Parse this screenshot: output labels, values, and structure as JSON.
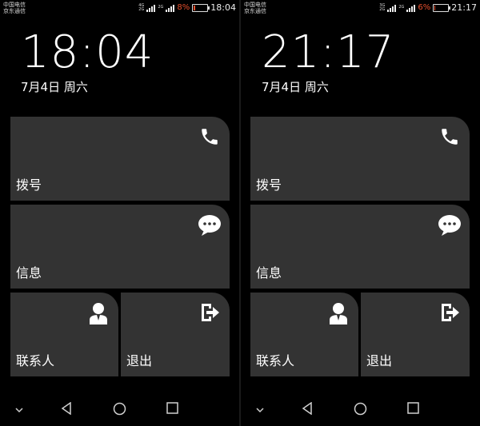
{
  "screens": [
    {
      "status": {
        "carrier1": "中国电信",
        "carrier2": "京东通信",
        "net1": "4G",
        "net2": "2G",
        "net3": "2G",
        "battery_pct": "8%",
        "battery_level": 0.08,
        "time": "18:04"
      },
      "clock": "18:04",
      "date": "7月4日 周六",
      "tiles": {
        "dial": "拨号",
        "message": "信息",
        "contacts": "联系人",
        "exit": "退出"
      }
    },
    {
      "status": {
        "carrier1": "中国电信",
        "carrier2": "京东通信",
        "net1": "3G",
        "net2": "2G",
        "net3": "2G",
        "battery_pct": "6%",
        "battery_level": 0.06,
        "time": "21:17"
      },
      "clock": "21:17",
      "date": "7月4日 周六",
      "tiles": {
        "dial": "拨号",
        "message": "信息",
        "contacts": "联系人",
        "exit": "退出"
      }
    }
  ],
  "icons": [
    "phone-icon",
    "message-icon",
    "contact-icon",
    "exit-icon",
    "back-icon",
    "home-icon",
    "recents-icon",
    "chevron-down-icon"
  ],
  "colors": {
    "tile": "#333333",
    "battery_low": "#e8502e",
    "background": "#000000"
  }
}
